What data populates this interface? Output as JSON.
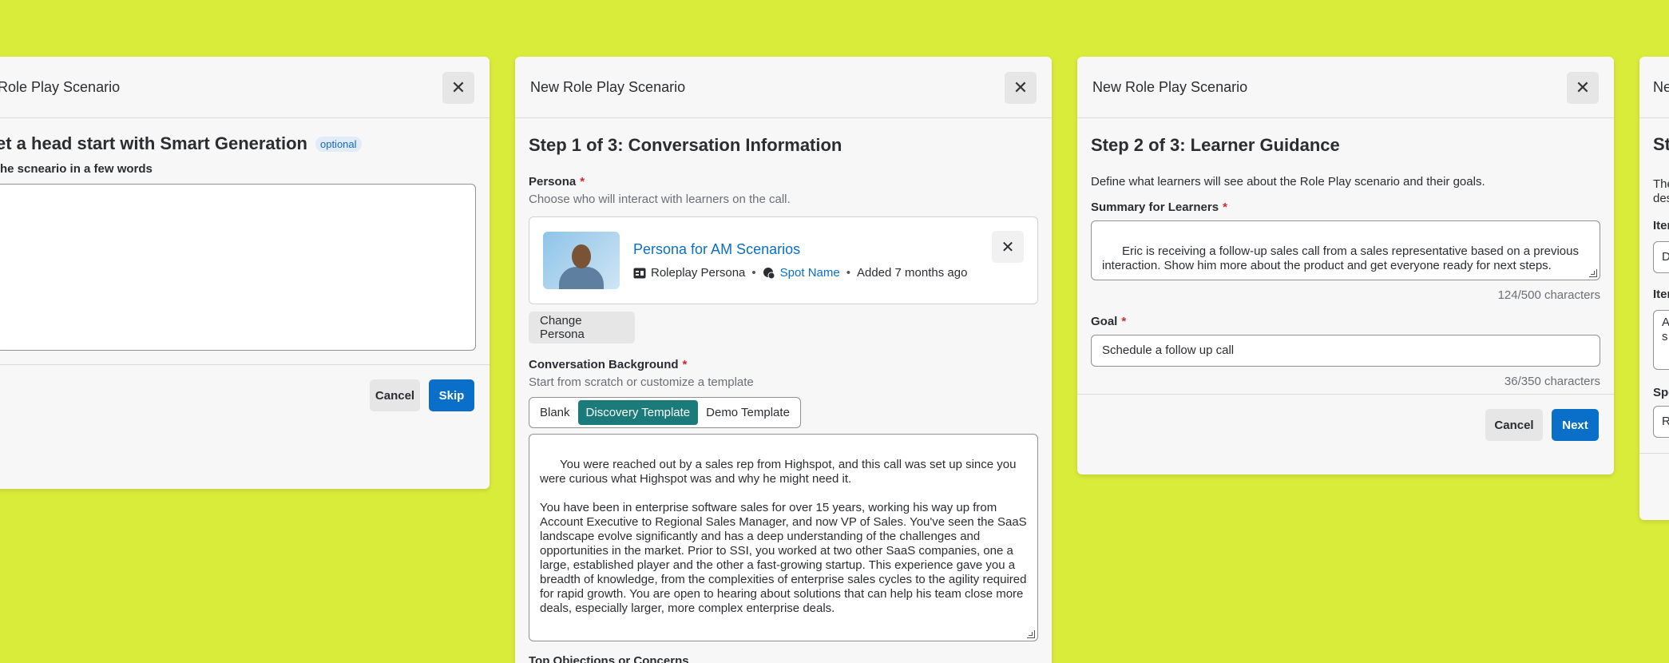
{
  "modal1": {
    "title": "Role Play Scenario",
    "heading": "et a head start with Smart Generation",
    "badge": "optional",
    "field_label": " the scneario in a few words",
    "textarea_value": "",
    "cancel_label": "Cancel",
    "skip_label": "Skip"
  },
  "modal2": {
    "title": "New Role Play Scenario",
    "step_title": "Step 1 of 3: Conversation Information",
    "persona_label": "Persona",
    "required_mark": "*",
    "persona_hint": "Choose who will interact with learners on the call.",
    "persona": {
      "name": "Persona for AM Scenarios",
      "type": "Roleplay Persona",
      "spot": "Spot Name",
      "added": "Added 7 months ago"
    },
    "change_persona_label": "Change Persona",
    "background_label": "Conversation Background",
    "background_hint": "Start from scratch or customize a template",
    "template_options": [
      "Blank",
      "Discovery Template",
      "Demo Template"
    ],
    "selected_template": "Discovery Template",
    "background_text": "You were reached out by a sales rep from Highspot, and this call was set up since you were curious what Highspot was and why he might need it.\n\nYou have been in enterprise software sales for over 15 years, working his way up from Account Executive to Regional Sales Manager, and now VP of Sales. You've seen the SaaS landscape evolve significantly and has a deep understanding of the challenges and opportunities in the market. Prior to SSI, you worked at two other SaaS companies, one a large, established player and the other a fast-growing startup. This experience gave you a breadth of knowledge, from the complexities of enterprise sales cycles to the agility required for rapid growth. You are open to hearing about solutions that can help his team close more deals, especially larger, more complex enterprise deals.",
    "next_section_label": "Top Objections or Concerns"
  },
  "modal3": {
    "title": "New Role Play Scenario",
    "step_title": "Step 2 of 3: Learner Guidance",
    "intro": "Define what learners will see about the Role Play scenario and their goals.",
    "summary_label": "Summary for Learners",
    "summary_value": "Eric is receiving a follow-up sales call from a sales representative based on a previous interaction. Show him more about the product and get everyone ready for next steps.",
    "summary_count": "124/500 characters",
    "goal_label": "Goal",
    "goal_value": "Schedule a follow up call",
    "goal_count": "36/350 characters",
    "cancel_label": "Cancel",
    "next_label": "Next"
  },
  "modal4": {
    "title": "Ne",
    "step_title": "St",
    "intro_line1": "The",
    "intro_line2": "des",
    "item_label_1": "Iter",
    "item_value_1": "D",
    "item_label_2": "Iter",
    "item_value_2a": "A",
    "item_value_2b": "s",
    "spot_label": "Spo",
    "spot_value": "R"
  }
}
